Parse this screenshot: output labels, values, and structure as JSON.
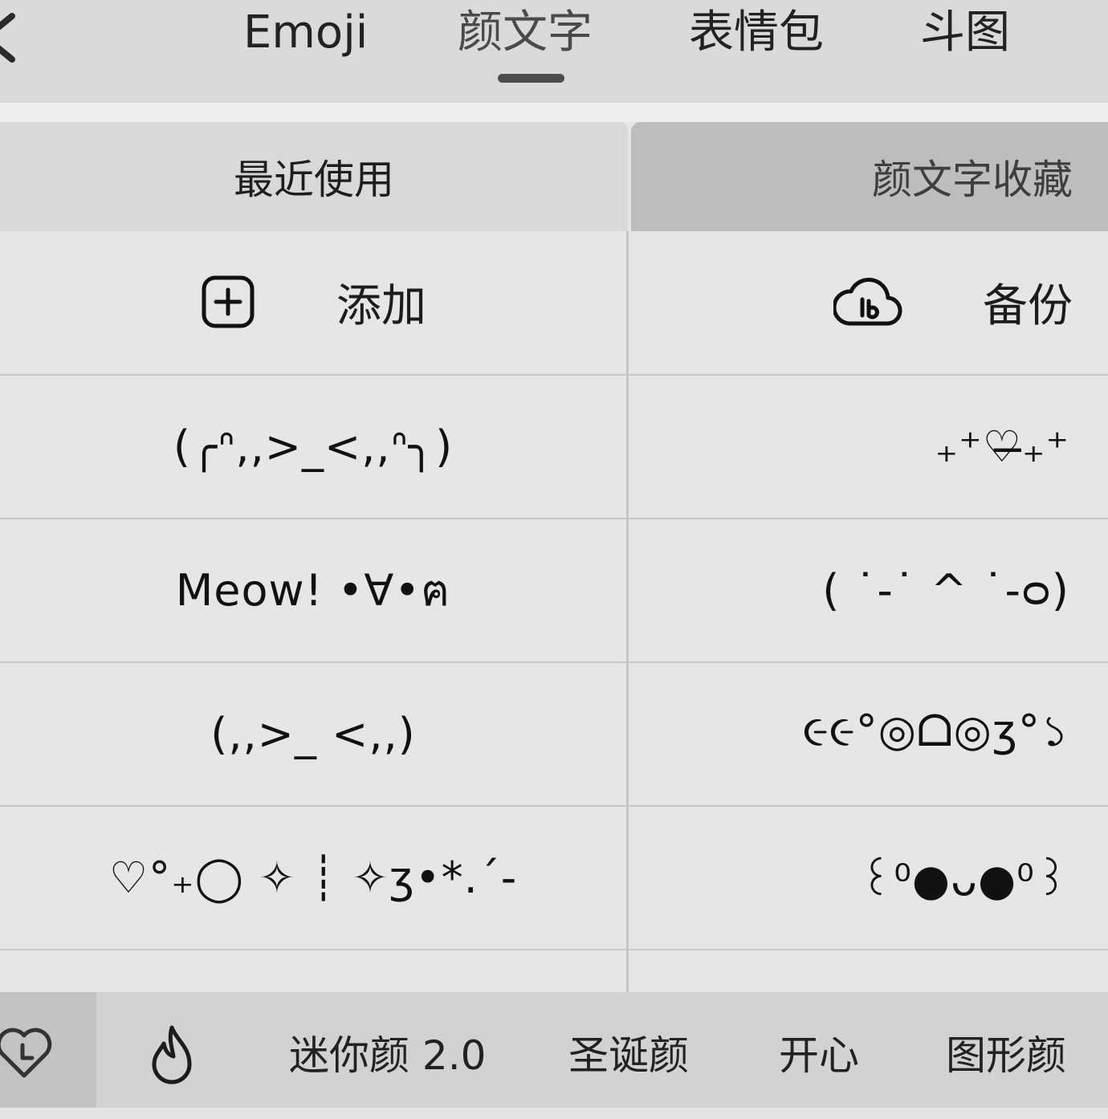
{
  "top_tabs": {
    "back_icon": "chevron-left-icon",
    "tabs": [
      {
        "label": "Emoji"
      },
      {
        "label": "颜文字"
      },
      {
        "label": "表情包"
      },
      {
        "label": "斗图"
      }
    ],
    "active_tab": "颜文字"
  },
  "segments": {
    "recent": "最近使用",
    "favorites": "颜文字收藏",
    "active": "颜文字收藏"
  },
  "actions": {
    "add_label": "添加",
    "add_icon": "plus-square-icon",
    "backup_label": "备份",
    "backup_icon": "cloud-upload-icon"
  },
  "left_items": [
    "(╭ᐢ,,>_<,,ᐢ╮)",
    "Meow! •∀•ฅ",
    "(,,>_ <,,)",
    "♡°₊◯ ✧ ┊ ✧ʒ•*.´-"
  ],
  "right_items": [
    "₊⁺♡̶₊⁺",
    "( ˙-˙ ^ ˙-ᴑ)",
    "૯૯°◎ᗝ◎ʒ°১",
    "꒰⁰●ᴗ●⁰꒱"
  ],
  "bottom_bar": {
    "history_icon": "heart-clock-icon",
    "hot_icon": "flame-icon",
    "items": [
      "迷你颜 2.0",
      "圣诞颜",
      "开心",
      "图形颜"
    ]
  }
}
